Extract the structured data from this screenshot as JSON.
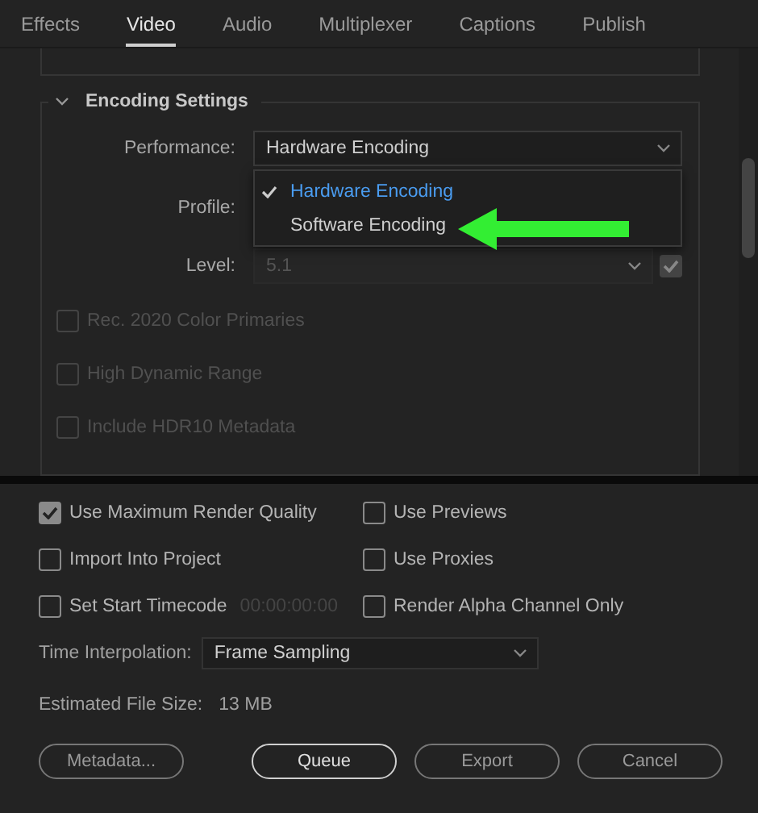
{
  "tabs": [
    {
      "label": "Effects",
      "selected": false
    },
    {
      "label": "Video",
      "selected": true
    },
    {
      "label": "Audio",
      "selected": false
    },
    {
      "label": "Multiplexer",
      "selected": false
    },
    {
      "label": "Captions",
      "selected": false
    },
    {
      "label": "Publish",
      "selected": false
    }
  ],
  "encoding": {
    "title": "Encoding Settings",
    "expanded": true,
    "performance": {
      "label": "Performance:",
      "value": "Hardware Encoding",
      "menu": [
        {
          "label": "Hardware Encoding",
          "selected": true
        },
        {
          "label": "Software Encoding",
          "selected": false
        }
      ]
    },
    "profile": {
      "label": "Profile:"
    },
    "level": {
      "label": "Level:",
      "value": "5.1",
      "disabled": true,
      "checked": true
    },
    "checkboxes": [
      {
        "label": "Rec. 2020 Color Primaries",
        "checked": false,
        "disabled": true
      },
      {
        "label": "High Dynamic Range",
        "checked": false,
        "disabled": true
      },
      {
        "label": "Include HDR10 Metadata",
        "checked": false,
        "disabled": true
      }
    ]
  },
  "options": [
    {
      "label": "Use Maximum Render Quality",
      "checked": true
    },
    {
      "label": "Use Previews",
      "checked": false
    },
    {
      "label": "Import Into Project",
      "checked": false
    },
    {
      "label": "Use Proxies",
      "checked": false
    },
    {
      "label": "Set Start Timecode",
      "checked": false,
      "timecode": "00:00:00:00"
    },
    {
      "label": "Render Alpha Channel Only",
      "checked": false
    }
  ],
  "time_interpolation": {
    "label": "Time Interpolation:",
    "value": "Frame Sampling"
  },
  "file_size": {
    "label": "Estimated File Size:",
    "value": "13 MB"
  },
  "buttons": [
    {
      "label": "Metadata...",
      "kind": "secondary"
    },
    {
      "label": "Queue",
      "kind": "primary"
    },
    {
      "label": "Export",
      "kind": "secondary"
    },
    {
      "label": "Cancel",
      "kind": "secondary"
    }
  ]
}
